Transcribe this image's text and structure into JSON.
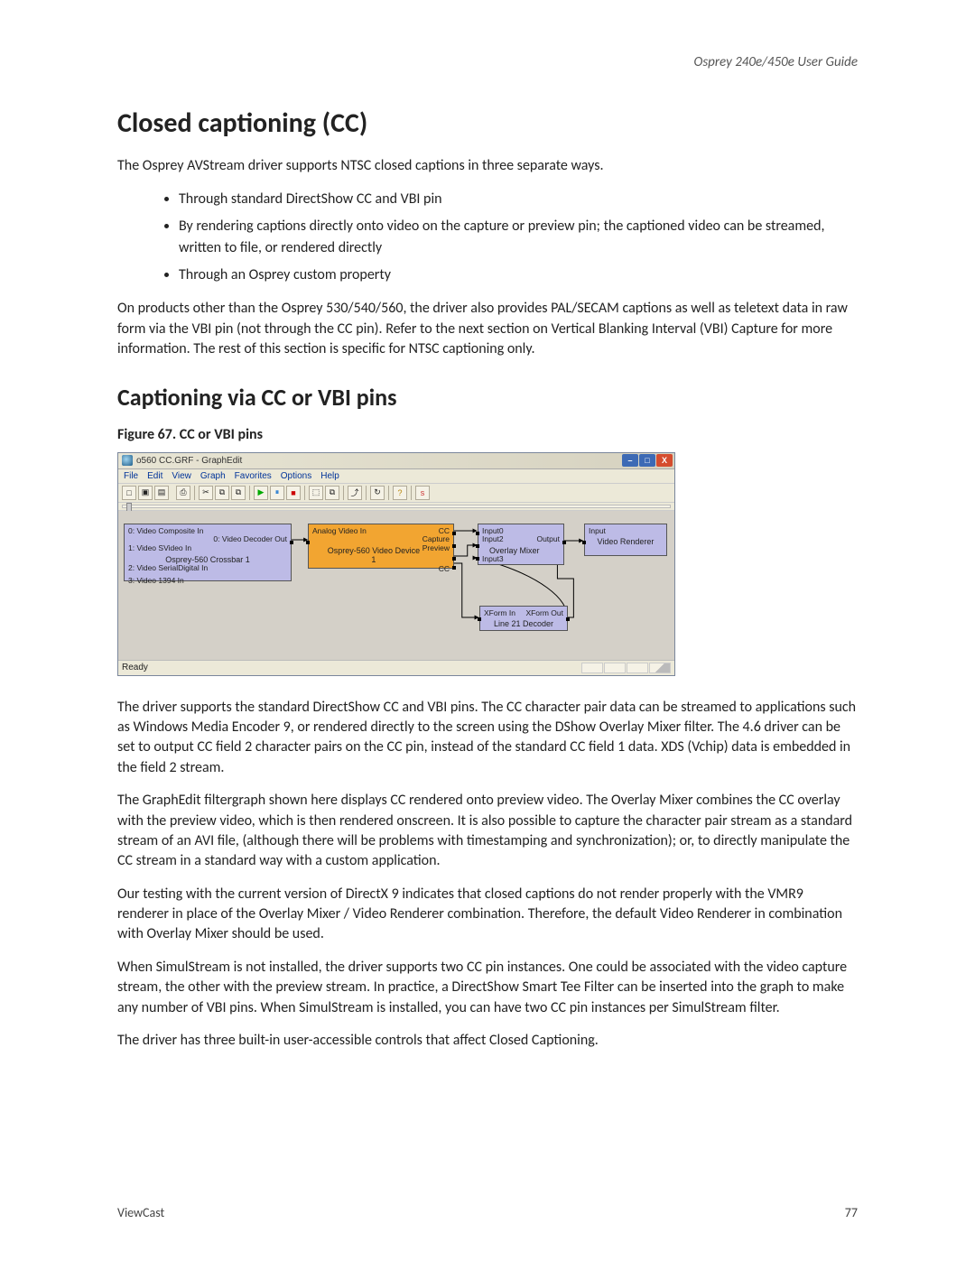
{
  "doc": {
    "header": "Osprey 240e/450e User Guide",
    "h1": "Closed captioning (CC)",
    "p1": "The Osprey AVStream driver supports NTSC closed captions in three separate ways.",
    "bullets": [
      "Through standard DirectShow CC and VBI pin",
      "By rendering captions directly onto video on the capture or preview pin; the captioned video can be streamed, written to file, or rendered directly",
      "Through an Osprey custom property"
    ],
    "p2": "On products other than the Osprey 530/540/560, the driver also provides PAL/SECAM captions as well as teletext data in raw form via the VBI pin (not through the CC pin). Refer to the next section on Vertical Blanking Interval (VBI) Capture for more information. The rest of this section is specific for NTSC captioning only.",
    "h2": "Captioning via CC or VBI pins",
    "figcaption": "Figure 67. CC or VBI pins",
    "p3": "The driver supports the standard DirectShow CC and VBI pins. The CC character pair data can be streamed to applications such as Windows Media Encoder 9, or rendered directly to the screen using the DShow Overlay Mixer filter. The 4.6 driver can be set to output CC field 2 character pairs on the CC pin, instead of the standard CC field 1 data. XDS (Vchip) data is embedded in the field 2 stream.",
    "p4": "The GraphEdit filtergraph shown here displays CC rendered onto preview video. The Overlay Mixer combines the CC overlay with the preview video, which is then rendered onscreen. It is also possible to capture the character pair stream as a standard stream of an AVI file, (although there will be problems with timestamping and synchronization); or, to directly manipulate the CC stream in a standard way with a custom application.",
    "p5": "Our testing with the current version of DirectX 9 indicates that closed captions do not render properly with the VMR9 renderer in place of the Overlay Mixer / Video Renderer combination. Therefore, the default Video Renderer in combination with Overlay Mixer should be used.",
    "p6": "When SimulStream is not installed, the driver supports two CC pin instances. One could be associated with the video capture stream, the other with the preview stream. In practice, a DirectShow Smart Tee Filter can be inserted into the graph to make any number of VBI pins. When SimulStream is installed, you can have two CC pin instances per SimulStream filter.",
    "p7": "The driver has three built-in user-accessible controls that affect Closed Captioning.",
    "footer_left": "ViewCast",
    "footer_right": "77"
  },
  "graphedit": {
    "title": "o560 CC.GRF - GraphEdit",
    "menu": [
      "File",
      "Edit",
      "View",
      "Graph",
      "Favorites",
      "Options",
      "Help"
    ],
    "status": "Ready",
    "winbtns": {
      "min": "–",
      "max": "□",
      "close": "X"
    },
    "toolbar_icons": [
      "□",
      "▣",
      "▤",
      "⎙",
      "✂",
      "⧉",
      "⧉",
      "▶",
      "⏸",
      "■",
      "⬚",
      "⧉",
      "⤴",
      "↻",
      "?",
      "s"
    ],
    "filters": {
      "crossbar": {
        "name": "Osprey-560 Crossbar 1",
        "pins": [
          "0: Video Composite In",
          "1: Video SVideo In",
          "2: Video SerialDigital In",
          "3: Video 1394 In"
        ],
        "out": "0: Video Decoder Out"
      },
      "device": {
        "name": "Osprey-560 Video Device 1",
        "in": "Analog Video In",
        "outs": [
          "CC",
          "Capture",
          "Preview",
          "CC"
        ]
      },
      "mixer": {
        "name": "Overlay Mixer",
        "ins": [
          "Input0",
          "Input2",
          "Input3"
        ],
        "out": "Output"
      },
      "decoder": {
        "name": "Line 21 Decoder",
        "in": "XForm In",
        "out": "XForm Out"
      },
      "renderer": {
        "name": "Video Renderer",
        "in": "Input"
      }
    }
  }
}
